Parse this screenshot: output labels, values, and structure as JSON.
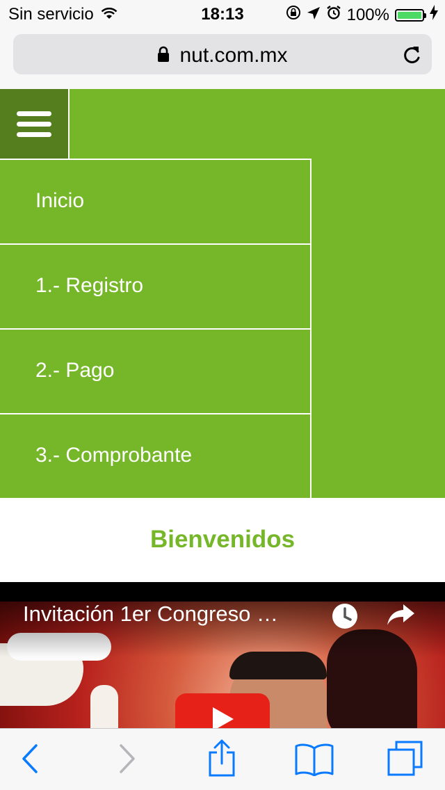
{
  "status_bar": {
    "carrier": "Sin servicio",
    "time": "18:13",
    "battery": "100%",
    "battery_level": 1.0,
    "battery_color": "#4cd964"
  },
  "browser": {
    "url": "nut.com.mx",
    "icons": [
      "lock-icon",
      "reload-icon"
    ]
  },
  "nav": {
    "background_color": "#76b72a",
    "toggle_color": "#557f1e",
    "menu_items": [
      {
        "label": "Inicio"
      },
      {
        "label": "1.- Registro"
      },
      {
        "label": "2.- Pago"
      },
      {
        "label": "3.- Comprobante"
      }
    ]
  },
  "main": {
    "heading": "Bienvenidos",
    "heading_color": "#76b72a"
  },
  "video": {
    "title": "Invitación 1er Congreso …",
    "icons": [
      "watch-later-icon",
      "share-icon",
      "play-icon"
    ],
    "play_color": "#e62117"
  },
  "toolbar": {
    "icons": [
      "back-icon",
      "forward-icon",
      "share-icon",
      "bookmarks-icon",
      "tabs-icon"
    ],
    "tint": "#0a7aff"
  }
}
